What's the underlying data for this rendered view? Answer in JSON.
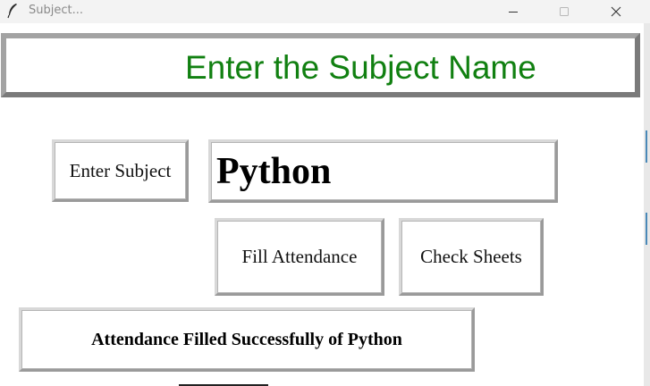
{
  "window": {
    "title": "Subject...",
    "icon": "feather-icon"
  },
  "header": {
    "title": "Enter the Subject Name",
    "color": "#118011"
  },
  "form": {
    "subject_label": "Enter Subject",
    "subject_value": "Python"
  },
  "buttons": {
    "fill_attendance": "Fill Attendance",
    "check_sheets": "Check Sheets"
  },
  "status": {
    "message": "Attendance Filled Successfully of Python"
  }
}
